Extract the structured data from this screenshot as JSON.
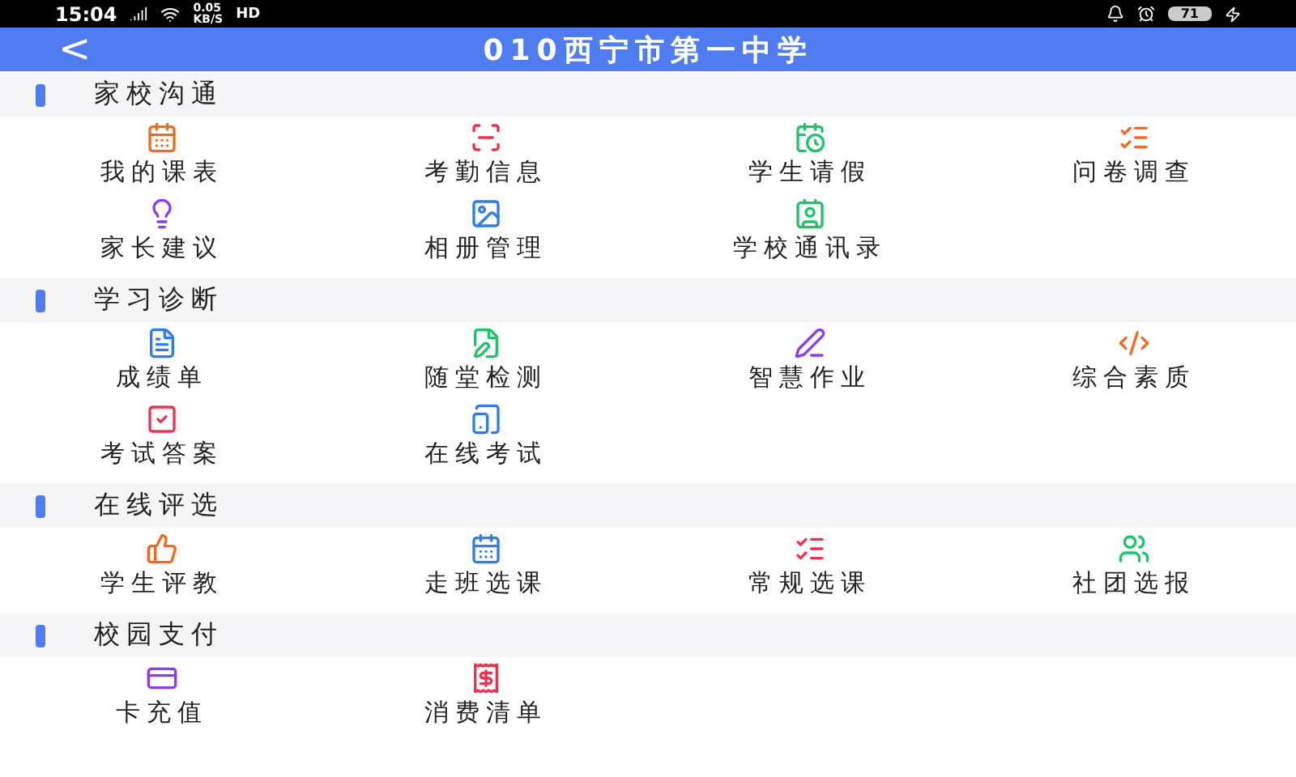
{
  "status_bar": {
    "time": "15:04",
    "net_speed": "0.05",
    "net_unit": "KB/S",
    "network_label": "HD",
    "battery": "71"
  },
  "header": {
    "back": "<",
    "title": "010西宁市第一中学"
  },
  "sections": [
    {
      "title": "家校沟通",
      "items": [
        {
          "label": "我的课表",
          "kind": "calendar",
          "color": "#f26a21"
        },
        {
          "label": "考勤信息",
          "kind": "scan",
          "color": "#f0304d"
        },
        {
          "label": "学生请假",
          "kind": "clock",
          "color": "#1fc46a"
        },
        {
          "label": "问卷调查",
          "kind": "list",
          "color": "#f26a21"
        },
        {
          "label": "家长建议",
          "kind": "bulb",
          "color": "#8a3cf0"
        },
        {
          "label": "相册管理",
          "kind": "image",
          "color": "#2f7cf0"
        },
        {
          "label": "学校通讯录",
          "kind": "contact",
          "color": "#1fc46a"
        }
      ]
    },
    {
      "title": "学习诊断",
      "items": [
        {
          "label": "成绩单",
          "kind": "grade",
          "color": "#2f7cf0"
        },
        {
          "label": "随堂检测",
          "kind": "edit",
          "color": "#1fc46a"
        },
        {
          "label": "智慧作业",
          "kind": "pen",
          "color": "#8a3cf0"
        },
        {
          "label": "综合素质",
          "kind": "code",
          "color": "#f26a21"
        },
        {
          "label": "考试答案",
          "kind": "check",
          "color": "#f0304d"
        },
        {
          "label": "在线考试",
          "kind": "tablet",
          "color": "#2f7cf0"
        }
      ]
    },
    {
      "title": "在线评选",
      "items": [
        {
          "label": "学生评教",
          "kind": "thumb",
          "color": "#f26a21"
        },
        {
          "label": "走班选课",
          "kind": "calendar",
          "color": "#2f7cf0"
        },
        {
          "label": "常规选课",
          "kind": "list",
          "color": "#f0304d"
        },
        {
          "label": "社团选报",
          "kind": "users",
          "color": "#1fc46a"
        }
      ]
    },
    {
      "title": "校园支付",
      "items": [
        {
          "label": "卡充值",
          "kind": "card",
          "color": "#8a3cf0"
        },
        {
          "label": "消费清单",
          "kind": "receipt",
          "color": "#f0304d"
        }
      ]
    }
  ]
}
